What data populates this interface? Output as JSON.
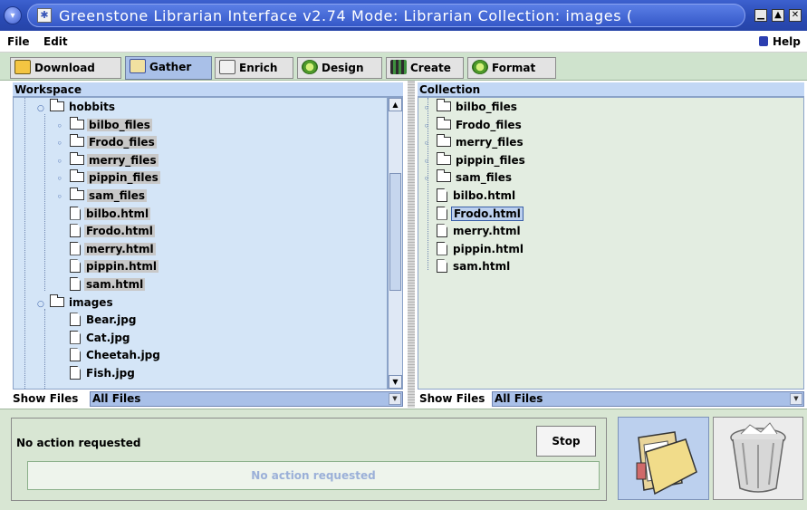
{
  "window": {
    "title": "Greenstone Librarian Interface v2.74  Mode: Librarian  Collection: images (",
    "minimize_glyph": "▁",
    "maximize_glyph": "▲",
    "close_glyph": "✕"
  },
  "menu": {
    "file": "File",
    "edit": "Edit",
    "help": "Help"
  },
  "tabs": [
    {
      "label": "Download",
      "icon": "download-icon",
      "active": false
    },
    {
      "label": "Gather",
      "icon": "gather-icon",
      "active": true
    },
    {
      "label": "Enrich",
      "icon": "enrich-icon",
      "active": false
    },
    {
      "label": "Design",
      "icon": "design-icon",
      "active": false
    },
    {
      "label": "Create",
      "icon": "create-icon",
      "active": false
    },
    {
      "label": "Format",
      "icon": "format-icon",
      "active": false
    }
  ],
  "workspace": {
    "title": "Workspace",
    "items": [
      {
        "label": "hobbits",
        "type": "folder",
        "level": 0,
        "expander": "expanded",
        "selected": false
      },
      {
        "label": "bilbo_files",
        "type": "folder",
        "level": 1,
        "expander": "collapsed",
        "selected": true
      },
      {
        "label": "Frodo_files",
        "type": "folder",
        "level": 1,
        "expander": "collapsed",
        "selected": true
      },
      {
        "label": "merry_files",
        "type": "folder",
        "level": 1,
        "expander": "collapsed",
        "selected": true
      },
      {
        "label": "pippin_files",
        "type": "folder",
        "level": 1,
        "expander": "collapsed",
        "selected": true
      },
      {
        "label": "sam_files",
        "type": "folder",
        "level": 1,
        "expander": "collapsed",
        "selected": true
      },
      {
        "label": "bilbo.html",
        "type": "file",
        "level": 1,
        "selected": true
      },
      {
        "label": "Frodo.html",
        "type": "file",
        "level": 1,
        "selected": true
      },
      {
        "label": "merry.html",
        "type": "file",
        "level": 1,
        "selected": true
      },
      {
        "label": "pippin.html",
        "type": "file",
        "level": 1,
        "selected": true
      },
      {
        "label": "sam.html",
        "type": "file",
        "level": 1,
        "selected": true
      },
      {
        "label": "images",
        "type": "folder",
        "level": 0,
        "expander": "expanded",
        "selected": false
      },
      {
        "label": "Bear.jpg",
        "type": "file",
        "level": 1,
        "selected": false
      },
      {
        "label": "Cat.jpg",
        "type": "file",
        "level": 1,
        "selected": false
      },
      {
        "label": "Cheetah.jpg",
        "type": "file",
        "level": 1,
        "selected": false
      },
      {
        "label": "Fish.jpg",
        "type": "file",
        "level": 1,
        "selected": false
      }
    ],
    "show_files_label": "Show Files",
    "show_files_value": "All Files"
  },
  "collection": {
    "title": "Collection",
    "items": [
      {
        "label": "bilbo_files",
        "type": "folder",
        "expander": "collapsed",
        "focused": false
      },
      {
        "label": "Frodo_files",
        "type": "folder",
        "expander": "collapsed",
        "focused": false
      },
      {
        "label": "merry_files",
        "type": "folder",
        "expander": "collapsed",
        "focused": false
      },
      {
        "label": "pippin_files",
        "type": "folder",
        "expander": "collapsed",
        "focused": false
      },
      {
        "label": "sam_files",
        "type": "folder",
        "expander": "collapsed",
        "focused": false
      },
      {
        "label": "bilbo.html",
        "type": "file",
        "focused": false
      },
      {
        "label": "Frodo.html",
        "type": "file",
        "focused": true
      },
      {
        "label": "merry.html",
        "type": "file",
        "focused": false
      },
      {
        "label": "pippin.html",
        "type": "file",
        "focused": false
      },
      {
        "label": "sam.html",
        "type": "file",
        "focused": false
      }
    ],
    "show_files_label": "Show Files",
    "show_files_value": "All Files"
  },
  "status": {
    "text": "No action requested",
    "stop_label": "Stop",
    "progress_text": "No action requested"
  },
  "actions": {
    "new_folder_icon": "open-folder-icon",
    "delete_icon": "trash-bin-icon"
  }
}
